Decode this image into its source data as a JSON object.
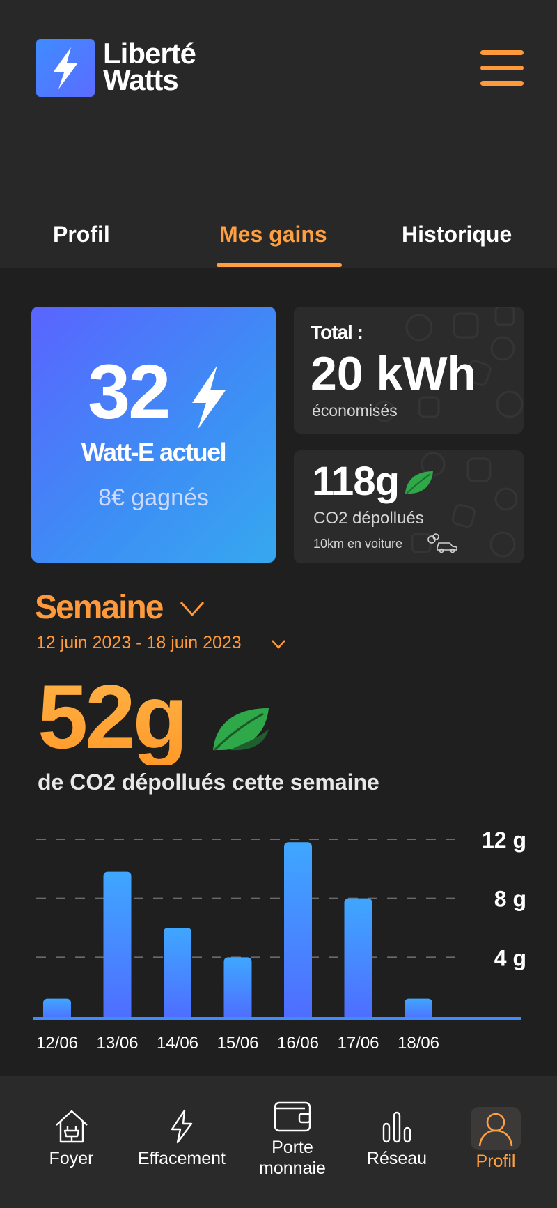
{
  "brand": {
    "line1": "Liberté",
    "line2": "Watts"
  },
  "tabs": [
    {
      "label": "Profil",
      "active": false
    },
    {
      "label": "Mes gains",
      "active": true
    },
    {
      "label": "Historique",
      "active": false
    }
  ],
  "main_card": {
    "value": "32",
    "label": "Watt-E actuel",
    "gained": "8€ gagnés"
  },
  "total_card": {
    "label": "Total :",
    "value": "20 kWh",
    "sub": "économisés"
  },
  "co2_card": {
    "value": "118g",
    "sub": "CO2 dépollués",
    "equivalent": "10km en voiture"
  },
  "period": {
    "label": "Semaine",
    "range": "12 juin 2023 - 18 juin 2023"
  },
  "week": {
    "value": "52g",
    "sub": "de CO2 dépollués cette semaine"
  },
  "chart_data": {
    "type": "bar",
    "categories": [
      "12/06",
      "13/06",
      "14/06",
      "15/06",
      "16/06",
      "17/06",
      "18/06"
    ],
    "values": [
      1.2,
      9.8,
      6.0,
      4.0,
      11.8,
      8.0,
      1.2
    ],
    "ylim": [
      0,
      12
    ],
    "yticks": [
      4,
      8,
      12
    ],
    "ytick_labels": [
      "4 g",
      "8 g",
      "12 g"
    ],
    "grid": true,
    "bar_color_top": "#3fa7ff",
    "bar_color_bottom": "#4f6cff"
  },
  "nav": [
    {
      "label": "Foyer",
      "icon": "house-plug-icon",
      "active": false
    },
    {
      "label": "Effacement",
      "icon": "lightning-icon",
      "active": false
    },
    {
      "label": "Porte monnaie",
      "icon": "wallet-icon",
      "active": false
    },
    {
      "label": "Réseau",
      "icon": "bars-icon",
      "active": false
    },
    {
      "label": "Profil",
      "icon": "user-icon",
      "active": true
    }
  ],
  "colors": {
    "accent": "#ff9f3f",
    "blue": "#4f6cff",
    "leaf": "#2fb34a"
  }
}
